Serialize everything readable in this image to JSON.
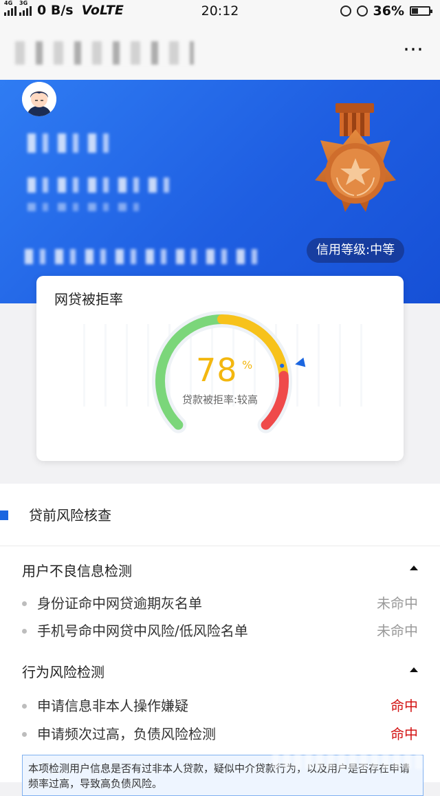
{
  "status_bar": {
    "network_small": "4G",
    "network_small2": "3G",
    "speed": "0 B/s",
    "volte": "VoLTE",
    "time": "20:12",
    "battery_pct": "36%",
    "battery_level": 0.36
  },
  "nav": {
    "more": "⋯"
  },
  "header": {
    "credit_level": "信用等级:中等",
    "medal_color": "#d9742d"
  },
  "card": {
    "title": "网贷被拒率",
    "value": "78",
    "value_unit": "%",
    "value_fraction": 0.78,
    "desc": "贷款被拒率:较高"
  },
  "section": {
    "title": "贷前风险核查"
  },
  "groups": [
    {
      "title": "用户不良信息检测",
      "items": [
        {
          "label": "身份证命中网贷逾期灰名单",
          "status": "未命中"
        },
        {
          "label": "手机号命中网贷中风险/低风险名单",
          "status": "未命中"
        }
      ]
    },
    {
      "title": "行为风险检测",
      "items": [
        {
          "label": "申请信息非本人操作嫌疑",
          "status": "命中"
        },
        {
          "label": "申请频次过高，负债风险检测",
          "status": "命中"
        }
      ]
    }
  ],
  "note": "本项检测用户信息是否有过非本人贷款，疑似中介贷款行为，以及用户是否存在申请频率过高，导致高负债风险。",
  "colors": {
    "primary": "#1f5fe2",
    "gauge_green": "#7bd67a",
    "gauge_yellow": "#f7c21b",
    "gauge_red": "#ef4a4a",
    "hit": "#d31313",
    "miss": "#9a9a9a"
  }
}
